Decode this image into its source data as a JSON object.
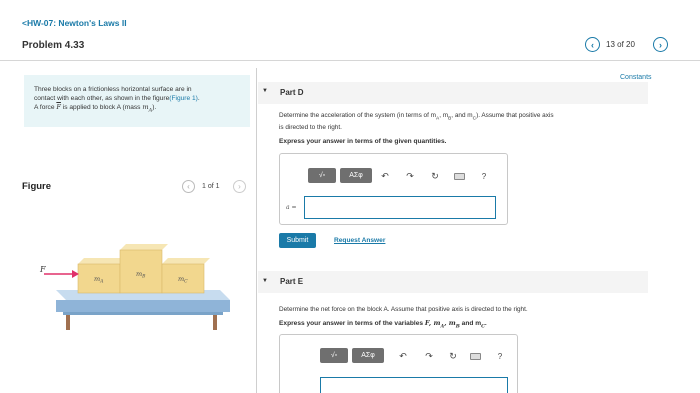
{
  "header": {
    "back_label": "<HW-07: Newton's Laws II",
    "problem_title": "Problem 4.33",
    "pager": {
      "prev_icon": "chevron-left-icon",
      "label": "13 of 20",
      "next_icon": "chevron-right-icon"
    }
  },
  "intro": {
    "line1": "Three blocks on a frictionless horizontal surface are in",
    "line2_pre": "contact with each other, as shown in the figure",
    "line2_link": "(Figure 1)",
    "line2_post": ".",
    "line3_pre": "A force ",
    "force_symbol": "F",
    "line3_mid": " is applied to block A (mass ",
    "mass_symbol": "m",
    "mass_sub": "A",
    "line3_post": ")."
  },
  "figure": {
    "label": "Figure",
    "counter": "1 of 1",
    "force_label": "F",
    "block_labels": [
      {
        "symbol": "m",
        "sub": "A"
      },
      {
        "symbol": "m",
        "sub": "B"
      },
      {
        "symbol": "m",
        "sub": "C"
      }
    ]
  },
  "constants_label": "Constants",
  "part_d": {
    "title": "Part D",
    "question_line1": "Determine the acceleration of the system (in terms of m",
    "sub_a": "A",
    "q_sep1": ", m",
    "sub_b": "B",
    "q_sep2": ", and m",
    "sub_c": "C",
    "q_end": "). Assume that positive axis",
    "question_line2": "is directed to the right.",
    "instruction": "Express your answer in terms of the given quantities.",
    "toolbar": {
      "template_label": "√▫",
      "greek_label": "ΑΣφ",
      "undo": "↶",
      "redo": "↷",
      "reset": "↻",
      "keyboard_icon": "keyboard-icon",
      "help": "?"
    },
    "answer_variable": "a =",
    "answer_value": "",
    "submit_label": "Submit",
    "request_label": "Request Answer"
  },
  "part_e": {
    "title": "Part E",
    "question": "Determine the net force on the block A. Assume that positive axis is directed to the right.",
    "instruction_pre": "Express your answer in terms of the variables ",
    "instruction_vars": "F, m",
    "instr_sub_a": "A",
    "instr_sep": ", m",
    "instr_sub_b": "B",
    "instr_and": " and m",
    "instr_sub_c": "C",
    "instr_end": ".",
    "toolbar": {
      "template_label": "√▫",
      "greek_label": "ΑΣφ",
      "undo": "↶",
      "redo": "↷",
      "reset": "↻",
      "keyboard_icon": "keyboard-icon",
      "help": "?"
    }
  }
}
